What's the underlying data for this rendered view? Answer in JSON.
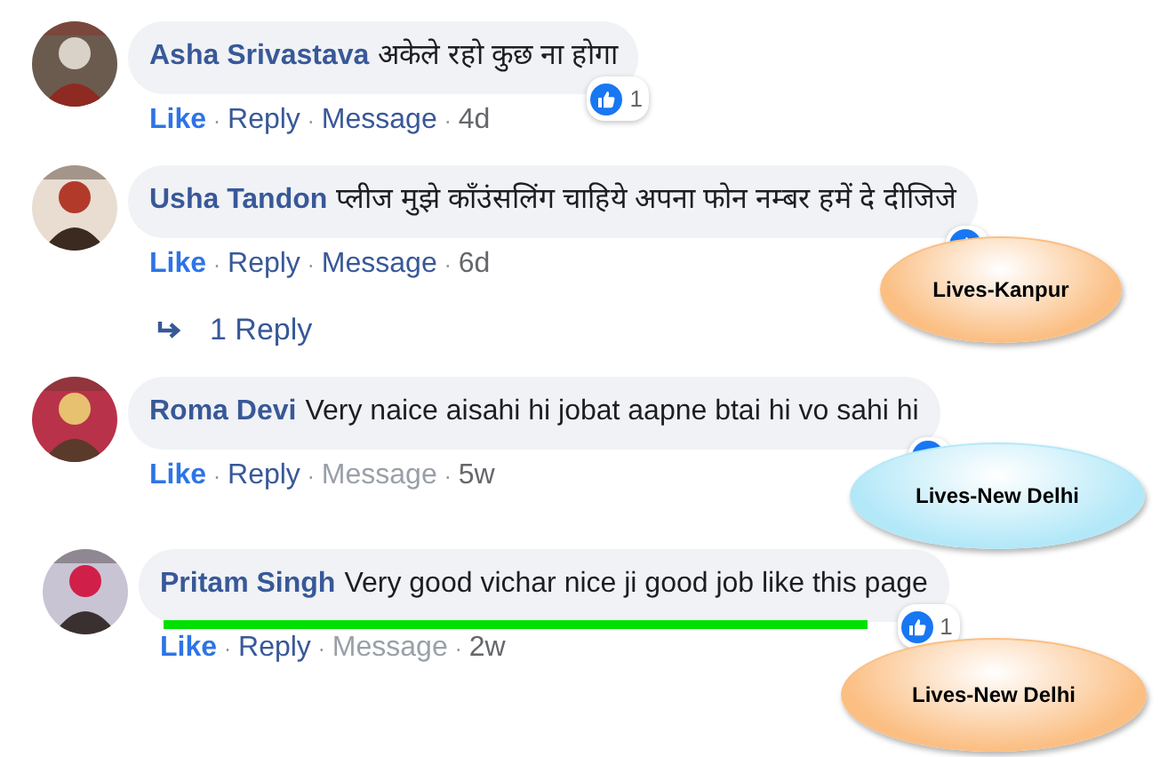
{
  "comments": [
    {
      "author": "Asha Srivastava",
      "text": "अकेले रहो कुछ ना होगा",
      "like_count": "1",
      "indent": false,
      "highlighted": false,
      "actions": {
        "like": "Like",
        "reply": "Reply",
        "message": "Message",
        "message_disabled": false,
        "time": "4d",
        "separator": "·"
      }
    },
    {
      "author": "Usha Tandon",
      "text": "प्लीज मुझे काँउंसलिंग चाहिये अपना फोन नम्बर हमें दे दीजिजे",
      "indent": false,
      "highlighted": false,
      "actions": {
        "like": "Like",
        "reply": "Reply",
        "message": "Message",
        "message_disabled": false,
        "time": "6d",
        "separator": "·"
      },
      "replies_link": "1 Reply",
      "annotation": {
        "label": "Lives-Kanpur",
        "color": "#fbbf84"
      }
    },
    {
      "author": "Roma Devi",
      "text": "Very naice aisahi hi jobat aapne btai hi vo sahi hi",
      "indent": false,
      "highlighted": false,
      "actions": {
        "like": "Like",
        "reply": "Reply",
        "message": "Message",
        "message_disabled": true,
        "time": "5w",
        "separator": "·"
      },
      "annotation": {
        "label": "Lives-New Delhi",
        "color": "#b3e8f8"
      }
    },
    {
      "author": "Pritam Singh",
      "text": "Very good vichar nice ji good job like this page",
      "like_count": "1",
      "indent": true,
      "highlighted": true,
      "actions": {
        "like": "Like",
        "reply": "Reply",
        "message": "Message",
        "message_disabled": true,
        "time": "2w",
        "separator": "·"
      },
      "annotation": {
        "label": "Lives-New Delhi",
        "color": "#fbbf84"
      }
    }
  ]
}
